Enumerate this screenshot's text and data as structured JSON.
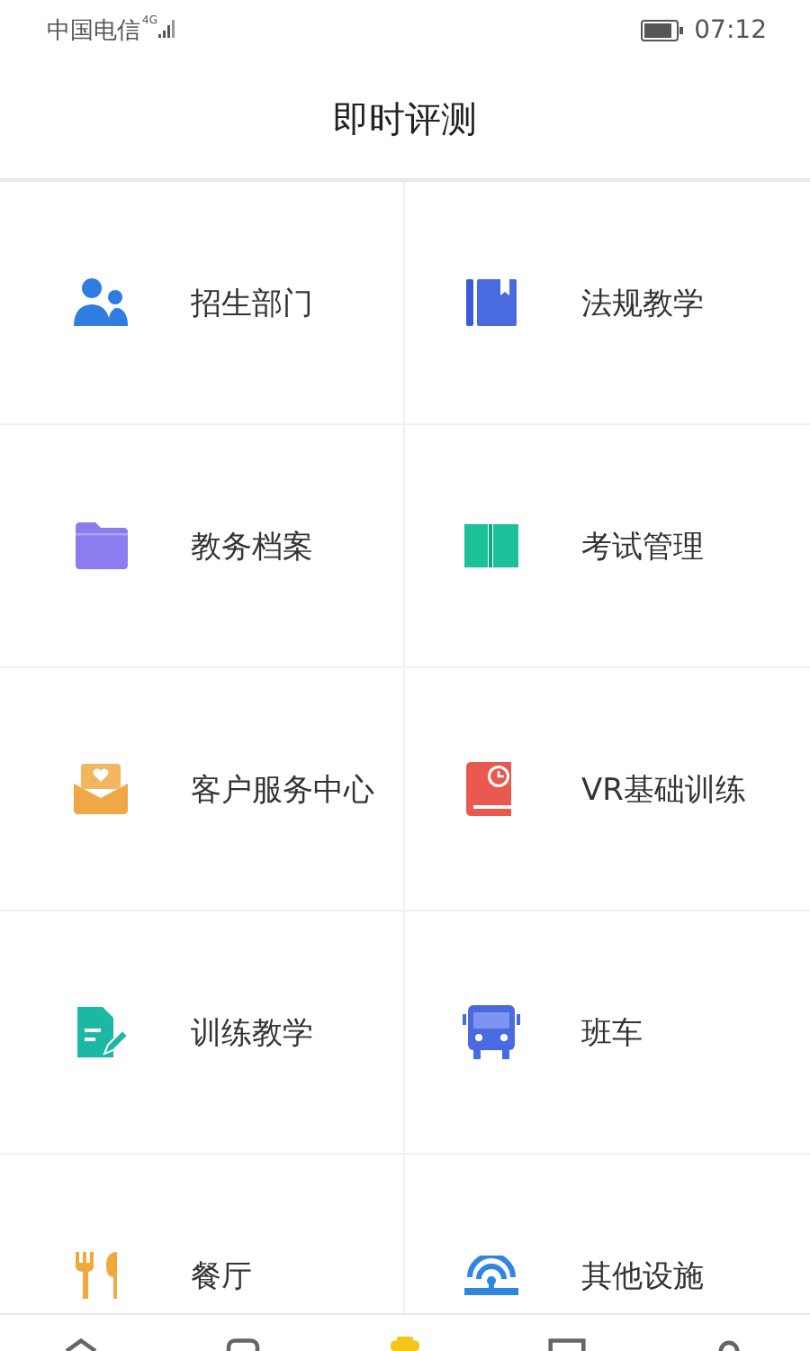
{
  "status_bar": {
    "carrier": "中国电信",
    "network": "4G",
    "time": "07:12"
  },
  "header": {
    "title": "即时评测"
  },
  "menu": [
    {
      "label": "招生部门"
    },
    {
      "label": "法规教学"
    },
    {
      "label": "教务档案"
    },
    {
      "label": "考试管理"
    },
    {
      "label": "客户服务中心"
    },
    {
      "label": "VR基础训练"
    },
    {
      "label": "训练教学"
    },
    {
      "label": "班车"
    },
    {
      "label": "餐厅"
    },
    {
      "label": "其他设施"
    }
  ],
  "tab_bar": [
    {
      "selected": false
    },
    {
      "selected": false
    },
    {
      "selected": true
    },
    {
      "selected": false
    },
    {
      "selected": false
    }
  ]
}
